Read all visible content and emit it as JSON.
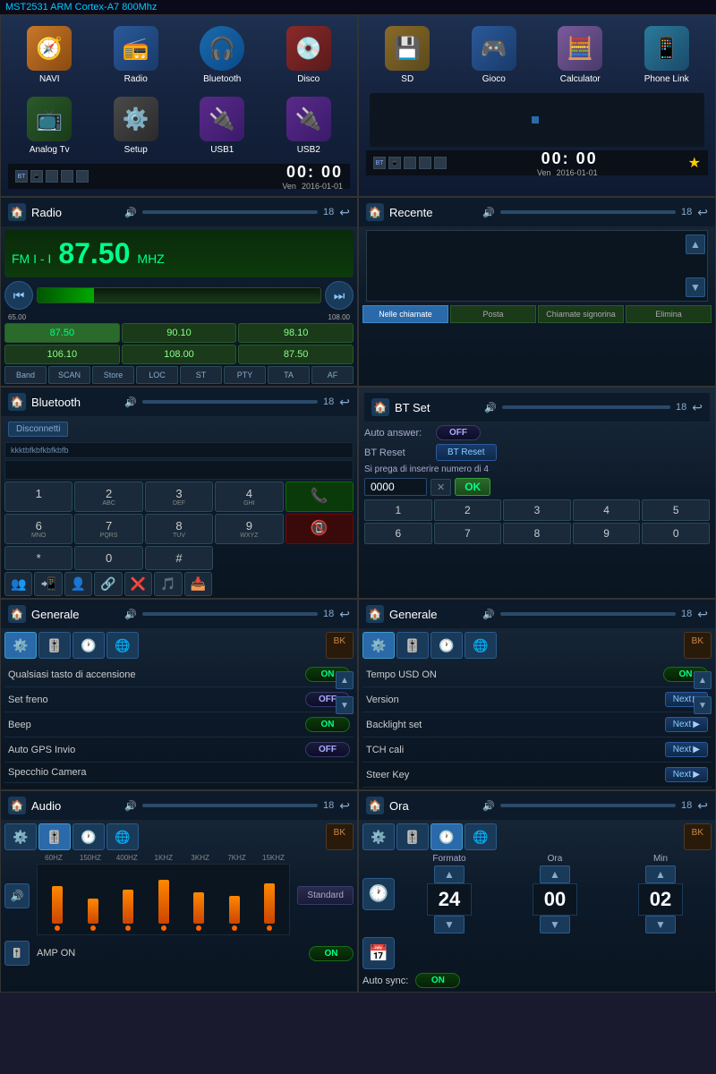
{
  "topBar": {
    "text": "MST2531 ARM Cortex-A7 800Mhz"
  },
  "row1": {
    "left": {
      "apps": [
        {
          "icon": "🧭",
          "label": "NAVI",
          "color": "#c8782a"
        },
        {
          "icon": "📻",
          "label": "Radio",
          "color": "#2a4a8a"
        },
        {
          "icon": "🎧",
          "label": "Bluetooth",
          "color": "#1a6aaa"
        },
        {
          "icon": "💿",
          "label": "Disco",
          "color": "#8a2a2a"
        }
      ],
      "apps2": [
        {
          "icon": "📺",
          "label": "Analog Tv",
          "color": "#2a4a2a"
        },
        {
          "icon": "⚙️",
          "label": "Setup",
          "color": "#3a3a3a"
        },
        {
          "icon": "🔌",
          "label": "USB1",
          "color": "#4a2a6a"
        },
        {
          "icon": "🔌",
          "label": "USB2",
          "color": "#4a2a6a"
        }
      ],
      "statusIcons": [
        "BT",
        "📱",
        "⬜",
        "⬜",
        "⬜"
      ],
      "time": "00: 00",
      "day": "Ven",
      "date": "2016-01-01"
    },
    "right": {
      "apps": [
        {
          "icon": "💾",
          "label": "SD",
          "color": "#8a6a2a"
        },
        {
          "icon": "🎮",
          "label": "Gioco",
          "color": "#2a4a8a"
        },
        {
          "icon": "🧮",
          "label": "Calculator",
          "color": "#6a4a8a"
        },
        {
          "icon": "📱",
          "label": "Phone Link",
          "color": "#2a6a8a"
        }
      ],
      "statusIcons": [
        "BT",
        "📱",
        "⬜",
        "⬜",
        "⬜"
      ],
      "time": "00: 00",
      "day": "Ven",
      "date": "2016-01-01",
      "star": "★"
    }
  },
  "row2": {
    "left": {
      "title": "Radio",
      "band": "FM I - I",
      "freq": "87.50",
      "unit": "MHZ",
      "min": "65.00",
      "max": "108.00",
      "presets": [
        "87.50",
        "90.10",
        "98.10",
        "106.10",
        "108.00",
        "87.50"
      ],
      "buttons": [
        "Band",
        "SCAN",
        "Store",
        "LOC",
        "ST",
        "PTY",
        "TA",
        "AF"
      ],
      "vol": "🔊",
      "num": "18",
      "back": "↩"
    },
    "right": {
      "title": "Recente",
      "vol": "🔊",
      "num": "18",
      "back": "↩",
      "tabs": [
        "Nelle chiamate",
        "Posta",
        "Chiamate signorina",
        "Elimina"
      ]
    }
  },
  "row3": {
    "left": {
      "title": "Bluetooth",
      "vol": "🔊",
      "num": "18",
      "back": "↩",
      "disconnect": "Disconnetti",
      "deviceId": "kkktbfkbfkbfkbfb",
      "keys": [
        {
          "label": "1",
          "sub": ""
        },
        {
          "label": "2",
          "sub": "ABC"
        },
        {
          "label": "3",
          "sub": "DEF"
        },
        {
          "label": "4",
          "sub": "GHI"
        },
        {
          "label": "call",
          "type": "green"
        },
        {
          "label": "6",
          "sub": "MNO"
        },
        {
          "label": "7",
          "sub": "PQRS"
        },
        {
          "label": "8",
          "sub": "TUV"
        },
        {
          "label": "9",
          "sub": "WXYZ"
        },
        {
          "label": "0",
          "sub": ""
        },
        {
          "label": "*",
          "sub": ""
        },
        {
          "label": "#",
          "sub": ""
        },
        {
          "label": "end",
          "type": "red"
        }
      ],
      "actions": [
        "👥",
        "📲",
        "👤",
        "🔗",
        "❌",
        "🎵",
        "📥"
      ]
    },
    "right": {
      "title": "BT Set",
      "vol": "🔊",
      "num": "18",
      "back": "↩",
      "autoAnswerLabel": "Auto answer:",
      "autoAnswerState": "OFF",
      "btResetLabel": "BT Reset",
      "btResetBtn": "BT Reset",
      "pinPrompt": "Si prega di inserire numero di 4",
      "pinValue": "0000",
      "okBtn": "OK",
      "numpad": [
        "1",
        "2",
        "3",
        "4",
        "5",
        "6",
        "7",
        "8",
        "9",
        "0"
      ]
    }
  },
  "row4": {
    "left": {
      "title": "Generale",
      "vol": "🔊",
      "num": "18",
      "back": "↩",
      "tabs": [
        "⚙️",
        "🎚️",
        "🕐",
        "🌐",
        "BK"
      ],
      "rows": [
        {
          "label": "Qualsiasi tasto di accensione",
          "toggle": "ON",
          "state": true
        },
        {
          "label": "Set freno",
          "toggle": "OFF",
          "state": false
        },
        {
          "label": "Beep",
          "toggle": "ON",
          "state": true
        },
        {
          "label": "Auto GPS Invio",
          "toggle": "OFF",
          "state": false
        },
        {
          "label": "Specchio Camera",
          "toggle": "",
          "state": false
        }
      ]
    },
    "right": {
      "title": "Generale",
      "vol": "🔊",
      "num": "18",
      "back": "↩",
      "tabs": [
        "⚙️",
        "🎚️",
        "🕐",
        "🌐",
        "BK"
      ],
      "rows": [
        {
          "label": "Tempo USD ON",
          "toggle": "ON",
          "state": true
        },
        {
          "label": "Version",
          "next": "Next"
        },
        {
          "label": "Backlight set",
          "next": "Next"
        },
        {
          "label": "TCH cali",
          "next": "Next"
        },
        {
          "label": "Steer Key",
          "next": "Next"
        }
      ]
    }
  },
  "row5": {
    "left": {
      "title": "Audio",
      "vol": "🔊",
      "num": "18",
      "back": "↩",
      "tabs": [
        "⚙️",
        "🎚️",
        "🕐",
        "🌐",
        "BK"
      ],
      "eqLabels": [
        "60HZ",
        "150HZ",
        "400HZ",
        "1KHZ",
        "3KHZ",
        "7KHZ",
        "15KHZ"
      ],
      "eqBars": [
        60,
        40,
        55,
        70,
        50,
        45,
        65
      ],
      "eqColors": [
        "#ff8800",
        "#ff8800",
        "#ff8800",
        "#ff8800",
        "#ff8800",
        "#ff8800",
        "#ff8800"
      ],
      "ampLabel": "AMP ON",
      "ampState": "ON",
      "standardBtn": "Standard"
    },
    "right": {
      "title": "Ora",
      "vol": "🔊",
      "num": "18",
      "back": "↩",
      "tabs": [
        "⚙️",
        "🎚️",
        "🕐",
        "🌐",
        "BK"
      ],
      "formatoLabel": "Formato",
      "oraLabel": "Ora",
      "minLabel": "Min",
      "formatoVal": "24",
      "oraVal": "00",
      "minVal": "02",
      "autoSyncLabel": "Auto sync:",
      "autoSyncState": "ON"
    }
  }
}
